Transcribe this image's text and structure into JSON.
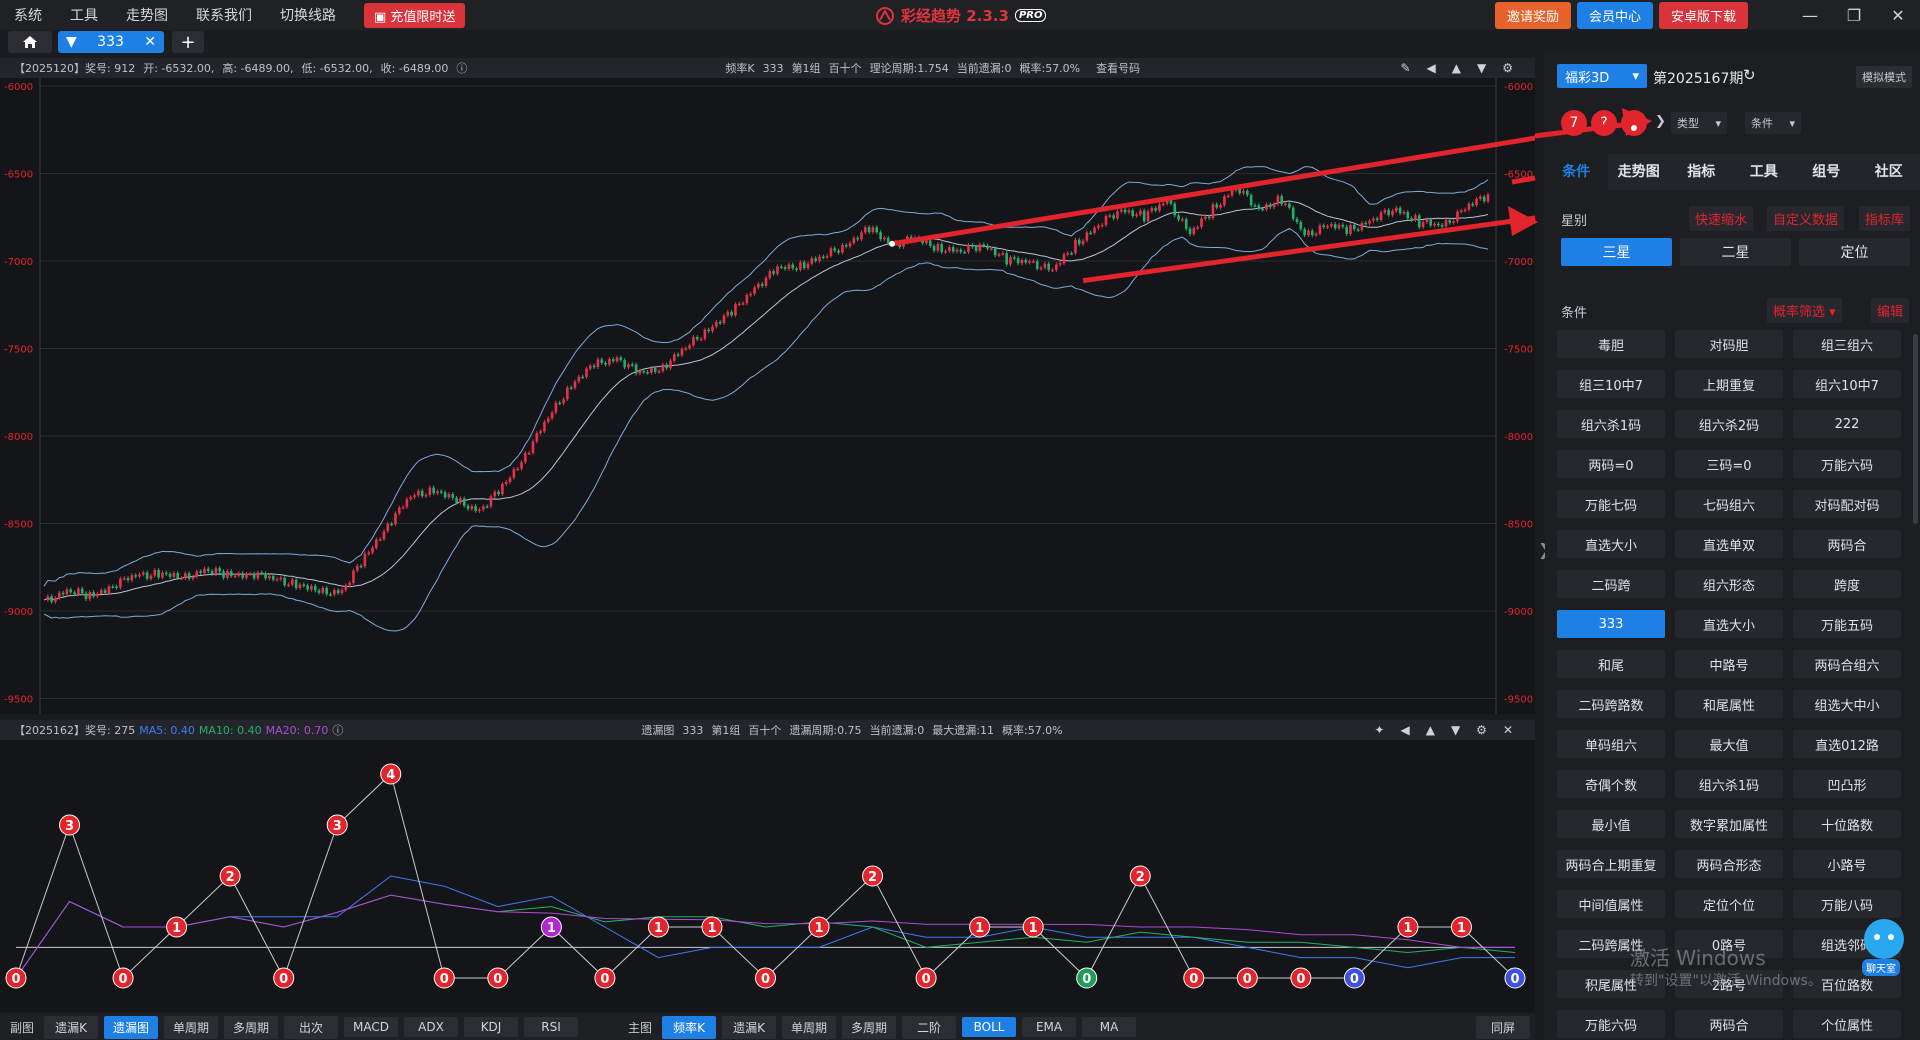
{
  "menu": {
    "items": [
      "系统",
      "工具",
      "走势图",
      "联系我们",
      "切换线路"
    ],
    "promo": "充值限时送"
  },
  "app": {
    "title": "彩经趋势 2.3.3",
    "badge": "PRO"
  },
  "top_right": {
    "invite": "邀请奖励",
    "member": "会员中心",
    "android": "安卓版下载"
  },
  "tabs": {
    "active_label": "333"
  },
  "main_chart": {
    "info": [
      "【2025120】奖号: 912",
      "开: -6532.00,",
      "高: -6489.00,",
      "低: -6532.00,",
      "收: -6489.00"
    ],
    "info2": [
      "频率K",
      "333",
      "第1组",
      "百十个",
      "理论周期:1.754",
      "当前遗漏:0",
      "概率:57.0%",
      "查看号码"
    ],
    "yticks": [
      "-6000",
      "-6500",
      "-7000",
      "-7500",
      "-8000",
      "-8500",
      "-9000",
      "-9500"
    ]
  },
  "sub_chart": {
    "info_prefix": "【2025162】奖号: 275",
    "ma5": "MA5: 0.40",
    "ma10": "MA10: 0.40",
    "ma20": "MA20: 0.70",
    "info2": [
      "遗漏图",
      "333",
      "第1组",
      "百十个",
      "遗漏周期:0.75",
      "当前遗漏:0",
      "最大遗漏:11",
      "概率:57.0%"
    ]
  },
  "chart_data": [
    {
      "type": "line",
      "title": "",
      "ylim": [
        -9500,
        -6000
      ],
      "series": [
        {
          "values": [
            -8950,
            -8880,
            -8920,
            -8850,
            -8800,
            -8780,
            -8820,
            -8760,
            -8800,
            -8780,
            -8820,
            -8840,
            -8900,
            -8880,
            -8700,
            -8500,
            -8350,
            -8300,
            -8380,
            -8420,
            -8300,
            -8100,
            -7900,
            -7700,
            -7600,
            -7550,
            -7650,
            -7600,
            -7500,
            -7380,
            -7300,
            -7150,
            -7050,
            -7020,
            -6980,
            -6900,
            -6820,
            -6900,
            -6880,
            -6920,
            -6950,
            -6900,
            -7000,
            -7000,
            -7060,
            -6900,
            -6800,
            -6700,
            -6750,
            -6650,
            -6850,
            -6700,
            -6580,
            -6700,
            -6650,
            -6850,
            -6800,
            -6820,
            -6760,
            -6700,
            -6780,
            -6800,
            -6700,
            -6620
          ]
        }
      ]
    },
    {
      "type": "line",
      "title": "",
      "ylim": [
        0,
        5
      ],
      "series": [
        {
          "values": [
            0,
            3,
            0,
            1,
            2,
            0,
            3,
            4,
            0,
            0,
            1,
            0,
            1,
            1,
            0,
            1,
            2,
            0,
            1,
            1,
            0,
            2,
            0,
            0,
            0,
            0,
            1,
            1,
            0
          ]
        }
      ]
    }
  ],
  "bottom_left": {
    "label": "副图",
    "buttons": [
      "遗漏K",
      "遗漏图",
      "单周期",
      "多周期",
      "出次",
      "MACD",
      "ADX",
      "KDJ",
      "RSI"
    ]
  },
  "bottom_right": {
    "label": "主图",
    "buttons": [
      "频率K",
      "遗漏K",
      "单周期",
      "多周期",
      "二阶",
      "BOLL",
      "EMA",
      "MA"
    ],
    "sync": "同屏"
  },
  "right_panel": {
    "lottery": "福彩3D",
    "period": "第2025167期",
    "sim_mode": "模拟模式",
    "balls": [
      "7",
      "?",
      "2"
    ],
    "type_sel": "类型",
    "cond_sel": "条件",
    "tabs": [
      "条件",
      "走势图",
      "指标",
      "工具",
      "组号",
      "社区"
    ],
    "star_label": "星别",
    "star_links": [
      "快速缩水",
      "自定义数据",
      "指标库"
    ],
    "star_options": [
      "三星",
      "二星",
      "定位"
    ],
    "cond_label": "条件",
    "cond_filter": "概率筛选",
    "cond_edit": "编辑",
    "conditions": [
      "毒胆",
      "对码胆",
      "组三组六",
      "组三10中7",
      "上期重复",
      "组六10中7",
      "组六杀1码",
      "组六杀2码",
      "222",
      "两码=0",
      "三码=0",
      "万能六码",
      "万能七码",
      "七码组六",
      "对码配对码",
      "直选大小",
      "直选单双",
      "两码合",
      "二码跨",
      "组六形态",
      "跨度",
      "333",
      "直选大小",
      "万能五码",
      "和尾",
      "中路号",
      "两码合组六",
      "二码跨路数",
      "和尾属性",
      "组选大中小",
      "单码组六",
      "最大值",
      "直选012路",
      "奇偶个数",
      "组六杀1码",
      "凹凸形",
      "最小值",
      "数字累加属性",
      "十位路数",
      "两码合上期重复",
      "两码合形态",
      "小路号",
      "中间值属性",
      "定位个位",
      "万能八码",
      "二码跨属性",
      "0路号",
      "组选邻码",
      "积尾属性",
      "2路号",
      "百位路数",
      "万能六码",
      "两码合",
      "个位属性"
    ]
  },
  "windows_watermark": {
    "line1": "激活 Windows",
    "line2": "转到\"设置\"以激活 Windows。"
  },
  "chat_label": "聊天室"
}
